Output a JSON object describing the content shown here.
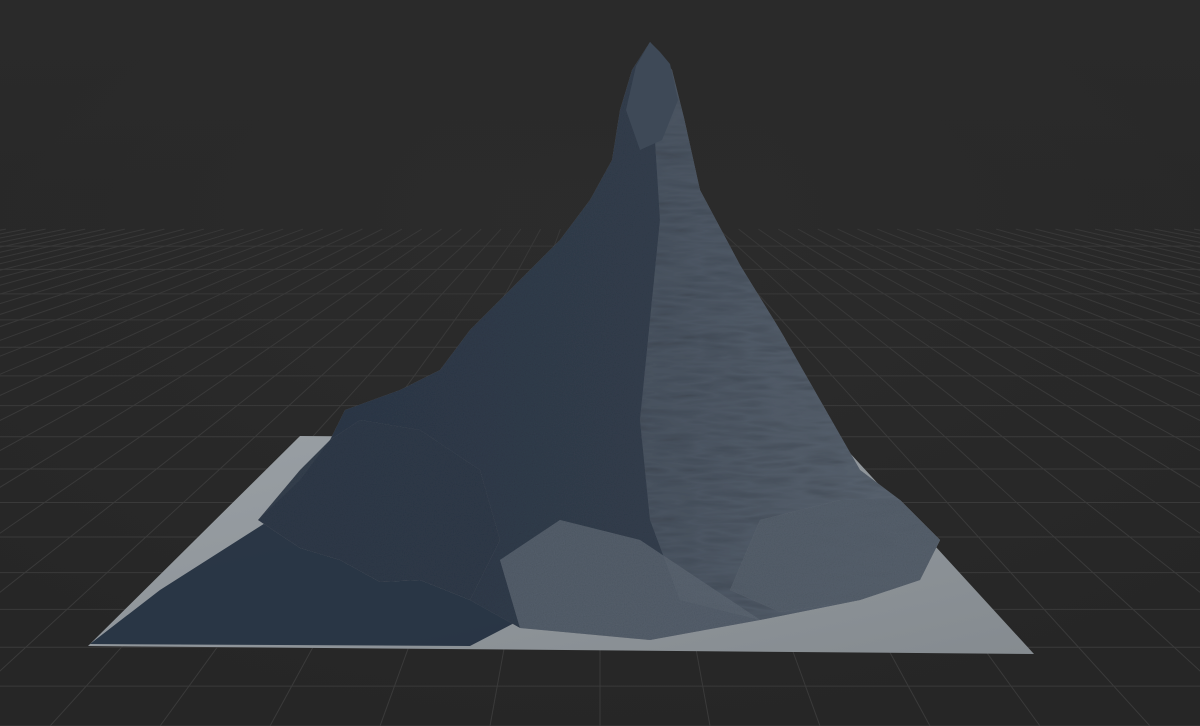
{
  "viewport": {
    "background_color": "#2a2a2a",
    "grid_color": "#3a3a3a"
  },
  "scene": {
    "objects": [
      {
        "name": "terrain-base-plane",
        "color": "#8e9499"
      },
      {
        "name": "mountain-mesh",
        "color": "#3d4855",
        "shadow_color": "#243040",
        "highlight_color": "#6f7a86"
      }
    ]
  }
}
